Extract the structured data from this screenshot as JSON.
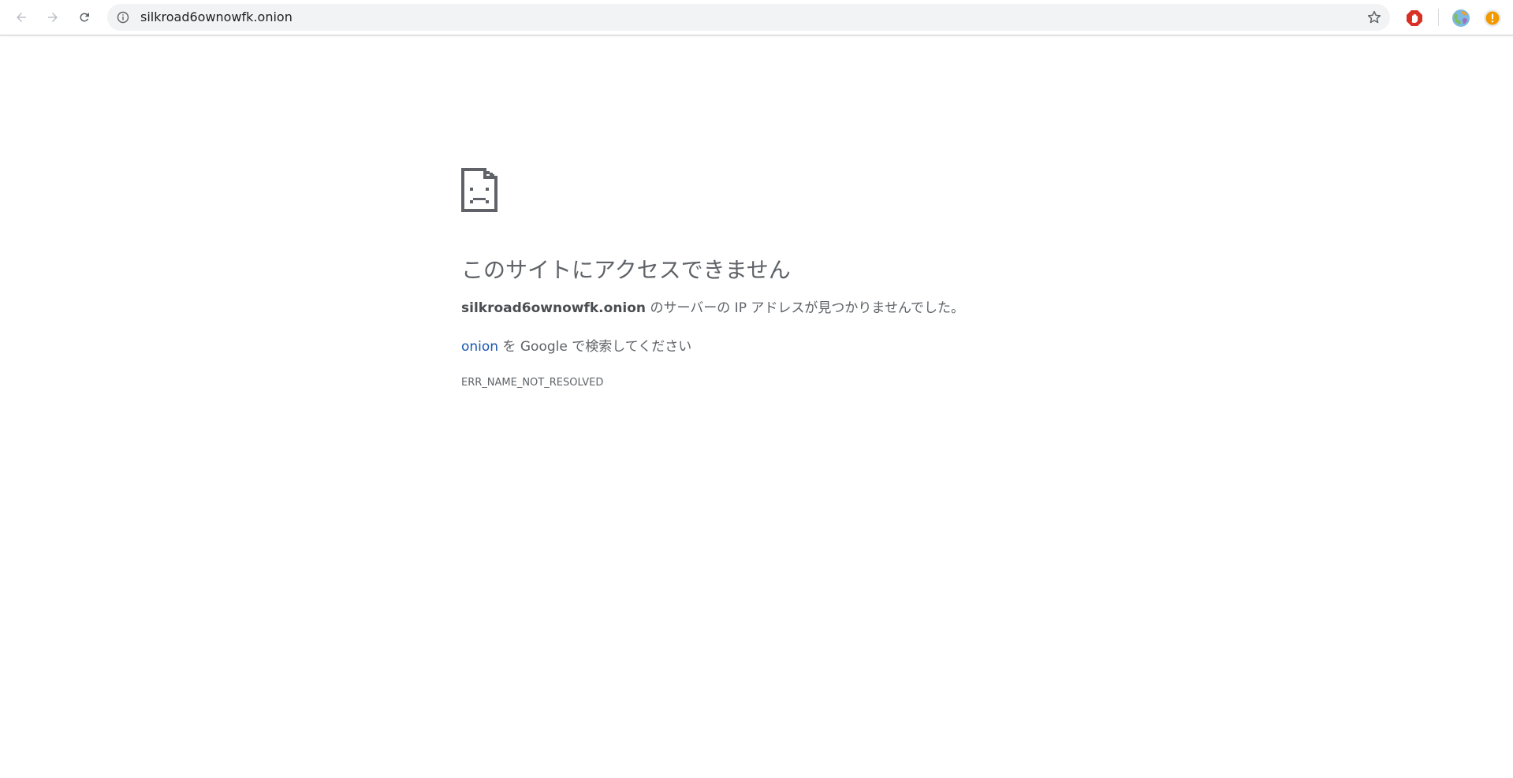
{
  "browser": {
    "url": "silkroad6ownowfk.onion",
    "icons": {
      "back": "arrow-left-icon",
      "forward": "arrow-right-icon",
      "reload": "reload-icon",
      "site_info": "info-icon",
      "bookmark": "star-icon",
      "extension_1": "stop-hand-icon",
      "extension_2": "globe-icon",
      "extension_3": "warning-icon"
    },
    "colors": {
      "omnibox_bg": "#f1f3f4",
      "extension_red": "#d93025",
      "extension_orange": "#f29900"
    }
  },
  "error_page": {
    "icon": "sad-document-icon",
    "title": "このサイトにアクセスできません",
    "host": "silkroad6ownowfk.onion",
    "description_suffix": " のサーバーの IP アドレスが見つかりませんでした。",
    "search_link_text": "onion",
    "search_suffix": " を Google で検索してください",
    "error_code": "ERR_NAME_NOT_RESOLVED",
    "colors": {
      "text": "#5f6368",
      "link": "#1a56b0"
    }
  }
}
